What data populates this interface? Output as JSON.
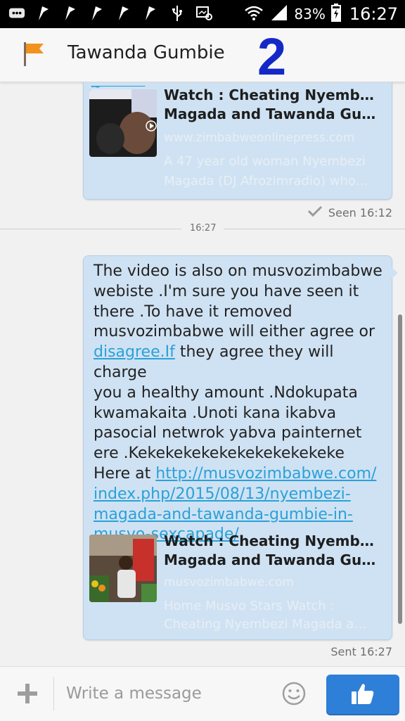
{
  "status_bar": {
    "battery_percent": "83%",
    "time": "16:27",
    "icons": [
      "bbm-icon",
      "flag-icon",
      "flag-icon",
      "flag-icon",
      "flag-icon",
      "flag-icon",
      "usb-icon",
      "screenshot-icon",
      "wifi-icon",
      "signal-icon",
      "battery-charging-icon"
    ]
  },
  "header": {
    "contact_name": "Tawanda Gumbie",
    "overlay_number": "2",
    "icon": "orange-flag-icon"
  },
  "messages": [
    {
      "direction": "outgoing",
      "link_preview": {
        "title_line1": "Watch : Cheating Nyembezi",
        "title_line2": "Magada and Tawanda Gumbi…",
        "domain": "www.zimbabweonlinepress.com",
        "description_line1": "A 47 year old woman Nyembezi",
        "description_line2": "Magada (DJ Afrozimradio) who…"
      },
      "status": "Seen 16:12",
      "status_icon": "check-icon"
    },
    {
      "direction": "outgoing",
      "text_lines": [
        "The video is also on musvozimbabwe",
        "webiste .I'm sure you have seen it",
        "there .To have it removed",
        "musvozimbabwe  will either agree or"
      ],
      "link_inline": "disagree.If",
      "text_after_link_line": " they agree they will charge",
      "text_lines_2": [
        "you a healthy amount .Ndokupata",
        "kwamakaita .Unoti kana ikabva",
        "pasocial netwrok yabva painternet",
        "ere .Kekekekekekekekekekekeke"
      ],
      "here_at": "Here at ",
      "url_lines": [
        "http://musvozimbabwe.com/",
        "index.php/2015/08/13/nyembezi-",
        "magada-and-tawanda-gumbie-in-",
        "musvo-sexcapade/"
      ],
      "link_preview": {
        "title_line1": "Watch : Cheating Nyembezi",
        "title_line2": "Magada and Tawanda Gumbi…",
        "domain": "musvozimbabwe.com",
        "description_line1": "Home Musvo Stars Watch :",
        "description_line2": "Cheating Nyembezi Magada a…"
      },
      "status": "Sent 16:27"
    }
  ],
  "time_divider": "16:27",
  "composer": {
    "placeholder": "Write a message",
    "plus_icon": "plus-icon",
    "emoji_icon": "smiley-icon",
    "send_icon": "thumbs-up-icon"
  },
  "colors": {
    "bubble": "#cfe2f3",
    "link": "#2aa1d8",
    "like_button": "#2e7fd8",
    "overlay_number": "#1428c8"
  }
}
